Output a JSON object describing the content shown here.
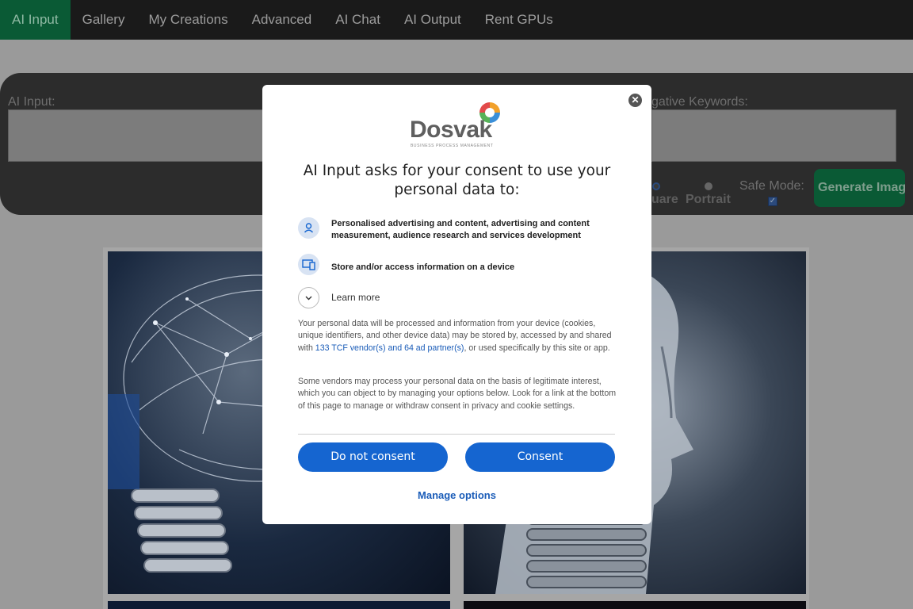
{
  "nav": {
    "items": [
      {
        "label": "AI Input",
        "active": true
      },
      {
        "label": "Gallery",
        "active": false
      },
      {
        "label": "My Creations",
        "active": false
      },
      {
        "label": "Advanced",
        "active": false
      },
      {
        "label": "AI Chat",
        "active": false
      },
      {
        "label": "AI Output",
        "active": false
      },
      {
        "label": "Rent GPUs",
        "active": false
      }
    ]
  },
  "form": {
    "ai_input_label": "AI Input:",
    "negative_keywords_label": "gative Keywords:",
    "orientation_options": [
      {
        "label": "uare",
        "selected": true
      },
      {
        "label": "Portrait",
        "selected": false
      }
    ],
    "safe_mode_label": "Safe Mode:",
    "safe_mode_checked": true,
    "generate_button": "Generate Image"
  },
  "consent": {
    "brand_name": "Dosvak",
    "brand_tagline": "BUSINESS PROCESS MANAGEMENT",
    "title": "AI Input asks for your consent to use your personal data to:",
    "purposes": [
      {
        "icon": "person-icon",
        "text": "Personalised advertising and content, advertising and content measurement, audience research and services development"
      },
      {
        "icon": "device-icon",
        "text": "Store and/or access information on a device"
      }
    ],
    "learn_more": "Learn more",
    "paragraph1_before": "Your personal data will be processed and information from your device (cookies, unique identifiers, and other device data) may be stored by, accessed by and shared with ",
    "paragraph1_link": "133 TCF vendor(s) and 64 ad partner(s)",
    "paragraph1_after": ", or used specifically by this site or app.",
    "paragraph2": "Some vendors may process your personal data on the basis of legitimate interest, which you can object to by managing your options below. Look for a link at the bottom of this page to manage or withdraw consent in privacy and cookie settings.",
    "do_not_consent": "Do not consent",
    "consent": "Consent",
    "manage_options": "Manage options"
  },
  "colors": {
    "nav_active": "#0a5a35",
    "button_primary": "#1565d0",
    "link": "#1a5cb8"
  }
}
